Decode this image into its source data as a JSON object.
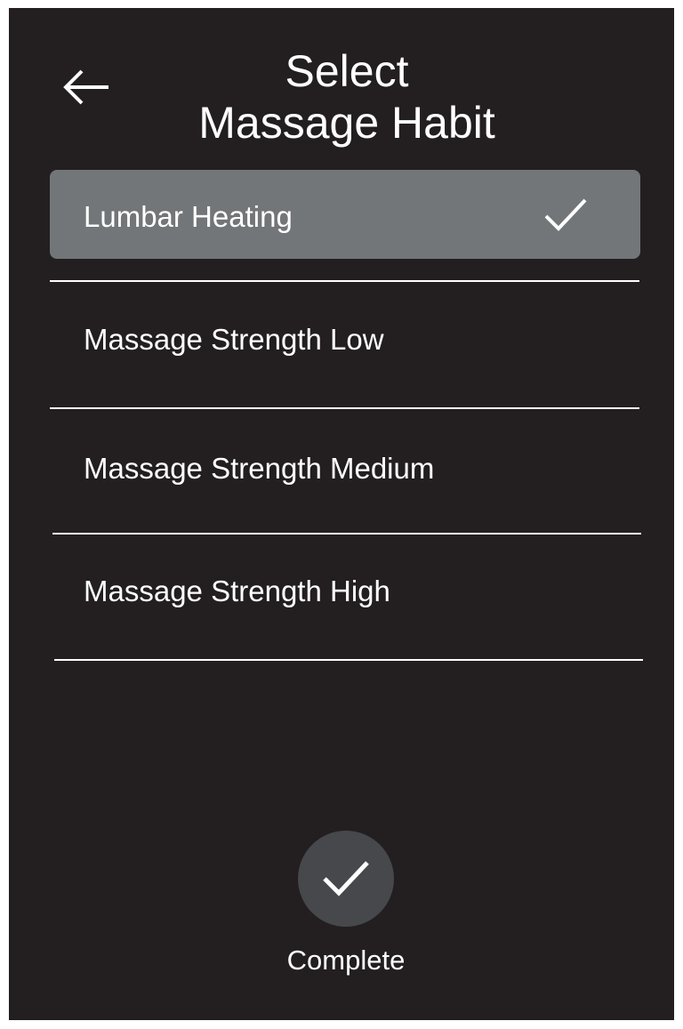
{
  "header": {
    "back_icon": "left-arrow-icon",
    "title_line1": "Select",
    "title_line2": "Massage Habit"
  },
  "options": [
    {
      "label": "Lumbar Heating",
      "selected": true,
      "icon": "check-icon"
    },
    {
      "label": "Massage Strength Low",
      "selected": false
    },
    {
      "label": "Massage Strength Medium",
      "selected": false
    },
    {
      "label": "Massage Strength High",
      "selected": false
    }
  ],
  "footer": {
    "complete_icon": "check-icon",
    "complete_label": "Complete"
  },
  "colors": {
    "background": "#231f20",
    "selected_row": "#737678",
    "complete_button": "#46484b",
    "text": "#ffffff"
  }
}
